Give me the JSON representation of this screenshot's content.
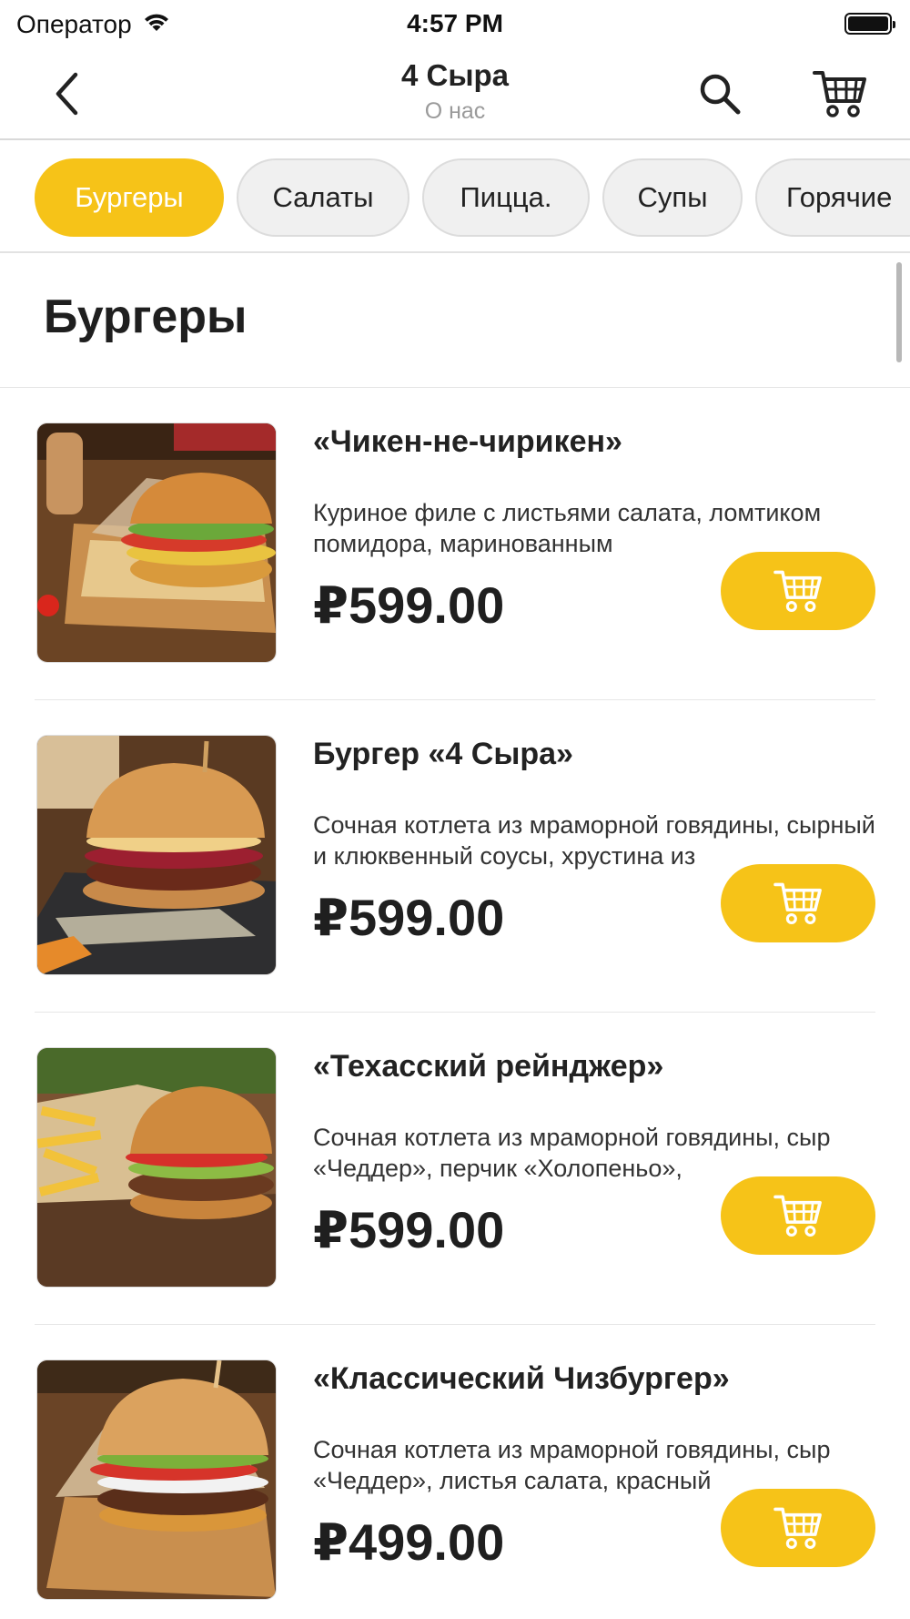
{
  "status_bar": {
    "carrier": "Оператор",
    "time": "4:57 PM"
  },
  "nav": {
    "title": "4 Сыра",
    "subtitle": "О нас"
  },
  "tabs": [
    {
      "label": "Бургеры",
      "active": true
    },
    {
      "label": "Салаты",
      "active": false
    },
    {
      "label": "Пицца.",
      "active": false
    },
    {
      "label": "Супы",
      "active": false
    },
    {
      "label": "Горячие",
      "active": false
    }
  ],
  "section": {
    "title": "Бургеры"
  },
  "items": [
    {
      "name": "«Чикен-не-чирикен»",
      "description": "Куриное филе с листьями салата, ломтиком помидора, маринованным",
      "price": "₽599.00"
    },
    {
      "name": "Бургер «4 Сыра»",
      "description": "Сочная котлета из мраморной говядины, сырный и клюквенный соусы, хрустина из",
      "price": "₽599.00"
    },
    {
      "name": "«Техасский рейнджер»",
      "description": "Сочная котлета из мраморной говядины, сыр «Чеддер», перчик «Холопеньо»,",
      "price": "₽599.00"
    },
    {
      "name": "«Классический Чизбургер»",
      "description": "Сочная котлета из мраморной говядины, сыр «Чеддер», листья салата, красный",
      "price": "₽499.00"
    }
  ],
  "colors": {
    "accent": "#f6c318",
    "tab_inactive": "#f0f0f0",
    "text": "#1f1f1f",
    "subtitle": "#9a9a9a"
  },
  "icons": {
    "back": "chevron-left-icon",
    "search": "search-icon",
    "cart": "cart-icon",
    "wifi": "wifi-icon",
    "battery": "battery-icon"
  }
}
